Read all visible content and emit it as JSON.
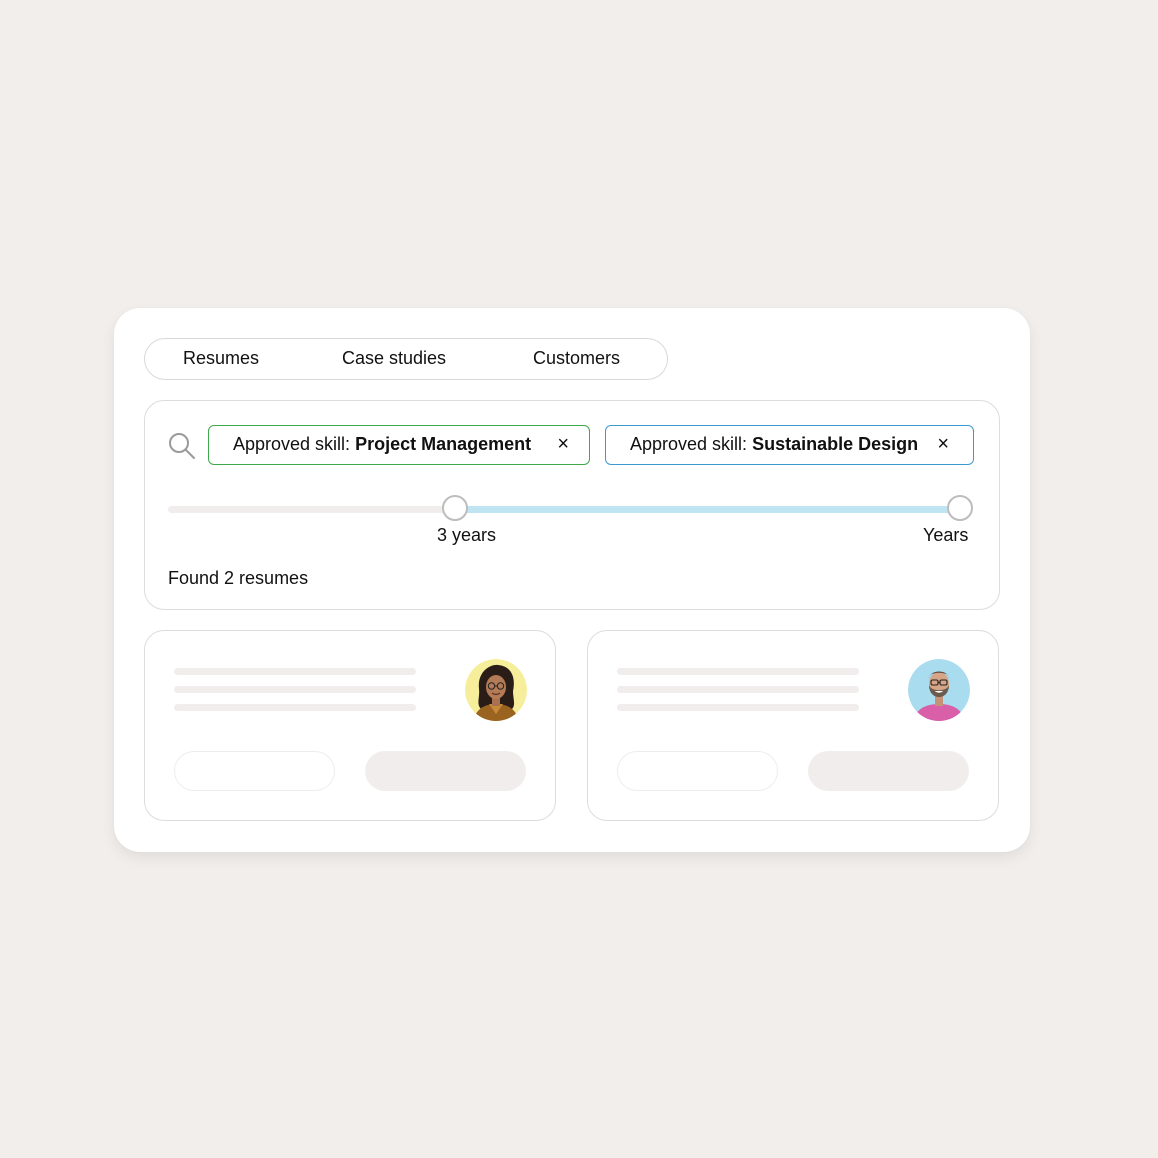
{
  "tabs": [
    {
      "label": "Resumes"
    },
    {
      "label": "Case studies"
    },
    {
      "label": "Customers"
    }
  ],
  "search": {
    "icon": "search-icon",
    "filters": [
      {
        "prefix": "Approved skill: ",
        "value": "Project Management",
        "close": "×",
        "border_color": "#3ea84a"
      },
      {
        "prefix": "Approved skill: ",
        "value": "Sustainable Design",
        "close": "×",
        "border_color": "#3a9ad0"
      }
    ]
  },
  "experience_slider": {
    "min_label": "3 years",
    "max_label": "Years",
    "selected_range_fraction": [
      0.36,
      1.0
    ],
    "fill_color": "#bfe4f2"
  },
  "results_summary": "Found 2 resumes",
  "results": [
    {
      "avatar": "woman-with-glasses-avatar",
      "avatar_bg": "#f6ee9a"
    },
    {
      "avatar": "bearded-man-avatar",
      "avatar_bg": "#a9dcef"
    }
  ]
}
